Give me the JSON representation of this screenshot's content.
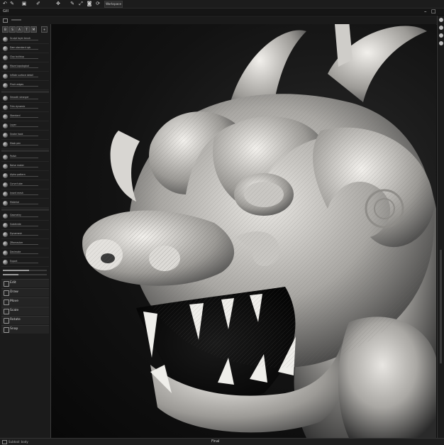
{
  "toolbar": {
    "doc_tab": "Workspace"
  },
  "menubar": {
    "title": "Gill",
    "window_min": "–",
    "window_max": "□"
  },
  "panel": {
    "rows": [
      {
        "label": "Sculpt layer brush"
      },
      {
        "label": "Dam standard rgb"
      },
      {
        "label": "Clay buildup"
      },
      {
        "label": "Move topological"
      },
      {
        "label": "Inflate surface detail"
      },
      {
        "label": "Pinch edges"
      },
      {
        "label": "Smooth stronger"
      },
      {
        "label": "Trim dynamic"
      },
      {
        "label": "Standard"
      },
      {
        "label": "Layer"
      },
      {
        "label": "Snake hook"
      },
      {
        "label": "Mask pen"
      },
      {
        "label": "Polish"
      },
      {
        "label": "Noise maker"
      },
      {
        "label": "Alpha pattern"
      },
      {
        "label": "Curve tube"
      },
      {
        "label": "Insert mesh"
      },
      {
        "label": "Material"
      },
      {
        "label": "Geometry"
      },
      {
        "label": "Subdivide"
      },
      {
        "label": "Dynamesh"
      },
      {
        "label": "ZRemesher"
      },
      {
        "label": "Decimate"
      },
      {
        "label": "Export"
      }
    ],
    "sliders": [
      {
        "value": 0.6
      },
      {
        "value": 0.35
      }
    ],
    "buttons": [
      {
        "label": "Edit"
      },
      {
        "label": "Draw"
      },
      {
        "label": "Move"
      },
      {
        "label": "Scale"
      },
      {
        "label": "Rotate"
      },
      {
        "label": "Snap"
      }
    ]
  },
  "status": {
    "left": "Subtool: body",
    "center": "Final"
  }
}
